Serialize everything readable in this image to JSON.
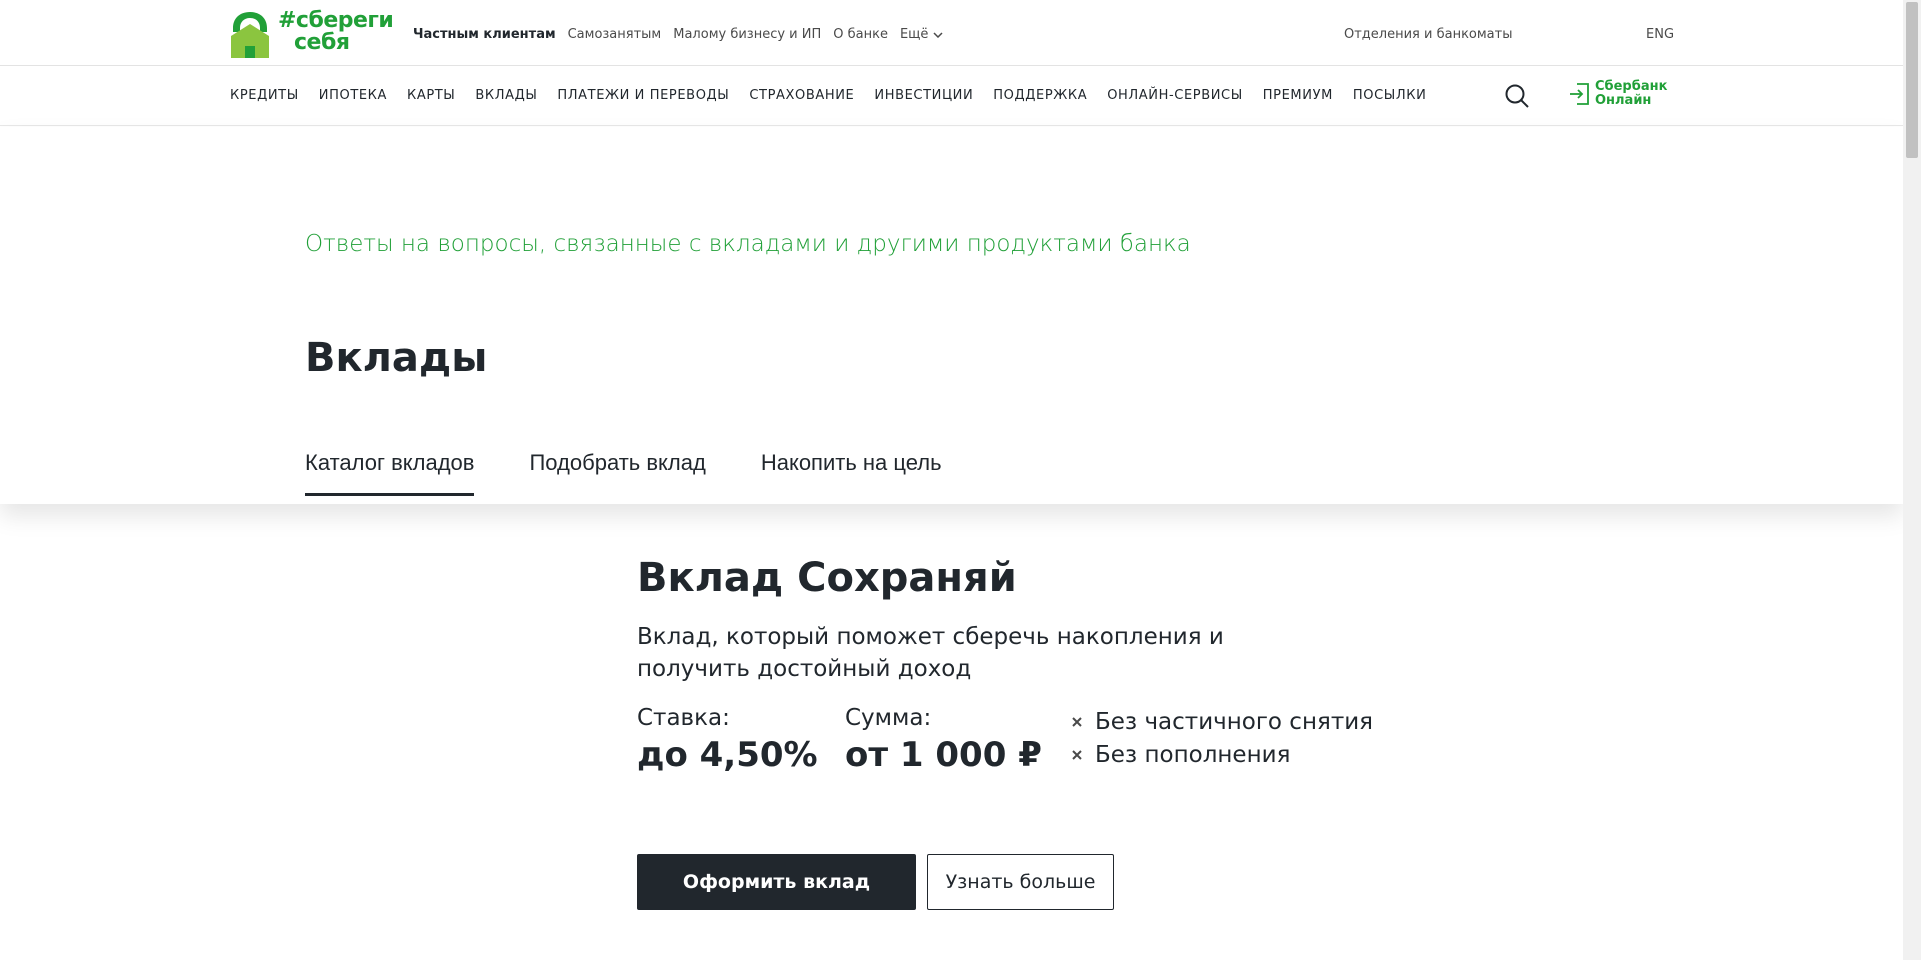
{
  "colors": {
    "brand_green": "#21a038",
    "text_dark": "#21272d",
    "button_dark": "#21272d"
  },
  "logo": {
    "line1": "#сбереги",
    "line2": "себя",
    "icon": "house-lock-logo-icon"
  },
  "top_links": [
    {
      "label": "Частным клиентам",
      "active": true
    },
    {
      "label": "Самозанятым"
    },
    {
      "label": "Малому бизнесу и ИП"
    },
    {
      "label": "О банке"
    },
    {
      "label": "Ещё",
      "icon": "chevron-down-icon"
    }
  ],
  "header_right": {
    "branches": "Отделения и банкоматы",
    "lang": "ENG"
  },
  "main_nav": [
    "КРЕДИТЫ",
    "ИПОТЕКА",
    "КАРТЫ",
    "ВКЛАДЫ",
    "ПЛАТЕЖИ И ПЕРЕВОДЫ",
    "СТРАХОВАНИЕ",
    "ИНВЕСТИЦИИ",
    "ПОДДЕРЖКА",
    "ОНЛАЙН-СЕРВИСЫ",
    "ПРЕМИУМ",
    "ПОСЫЛКИ"
  ],
  "sbol": {
    "line1": "Сбербанк",
    "line2": "Онлайн",
    "icon": "login-icon"
  },
  "hero": {
    "faq_link": "Ответы на вопросы, связанные с вкладами и другими продуктами банка",
    "title": "Вклады",
    "tabs": [
      {
        "label": "Каталог вкладов",
        "active": true
      },
      {
        "label": "Подобрать вклад"
      },
      {
        "label": "Накопить на цель"
      }
    ]
  },
  "deposit": {
    "title": "Вклад Сохраняй",
    "description": "Вклад, который поможет сберечь накопления и получить достойный доход",
    "rate_label": "Ставка:",
    "rate_value": "до 4,50%",
    "sum_label": "Сумма:",
    "sum_value": "от 1 000 ₽",
    "conditions": [
      "Без частичного снятия",
      "Без пополнения"
    ],
    "primary_button": "Оформить вклад",
    "secondary_button": "Узнать больше"
  }
}
